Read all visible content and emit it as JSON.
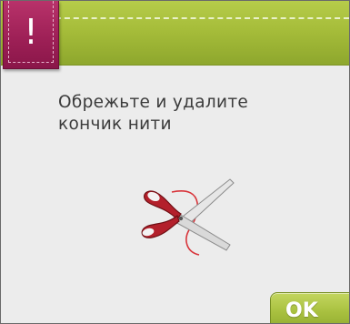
{
  "alert": {
    "symbol": "!",
    "message_line1": "Обрежьте и удалите",
    "message_line2": "кончик нити"
  },
  "illustration": {
    "icon": "scissors-cut-thread-icon"
  },
  "buttons": {
    "ok_label": "OK"
  },
  "colors": {
    "header_green": "#a6bd3a",
    "alert_magenta": "#9c1f55",
    "background": "#ececec",
    "text": "#3b3b3b",
    "thread_red": "#d8343a"
  }
}
